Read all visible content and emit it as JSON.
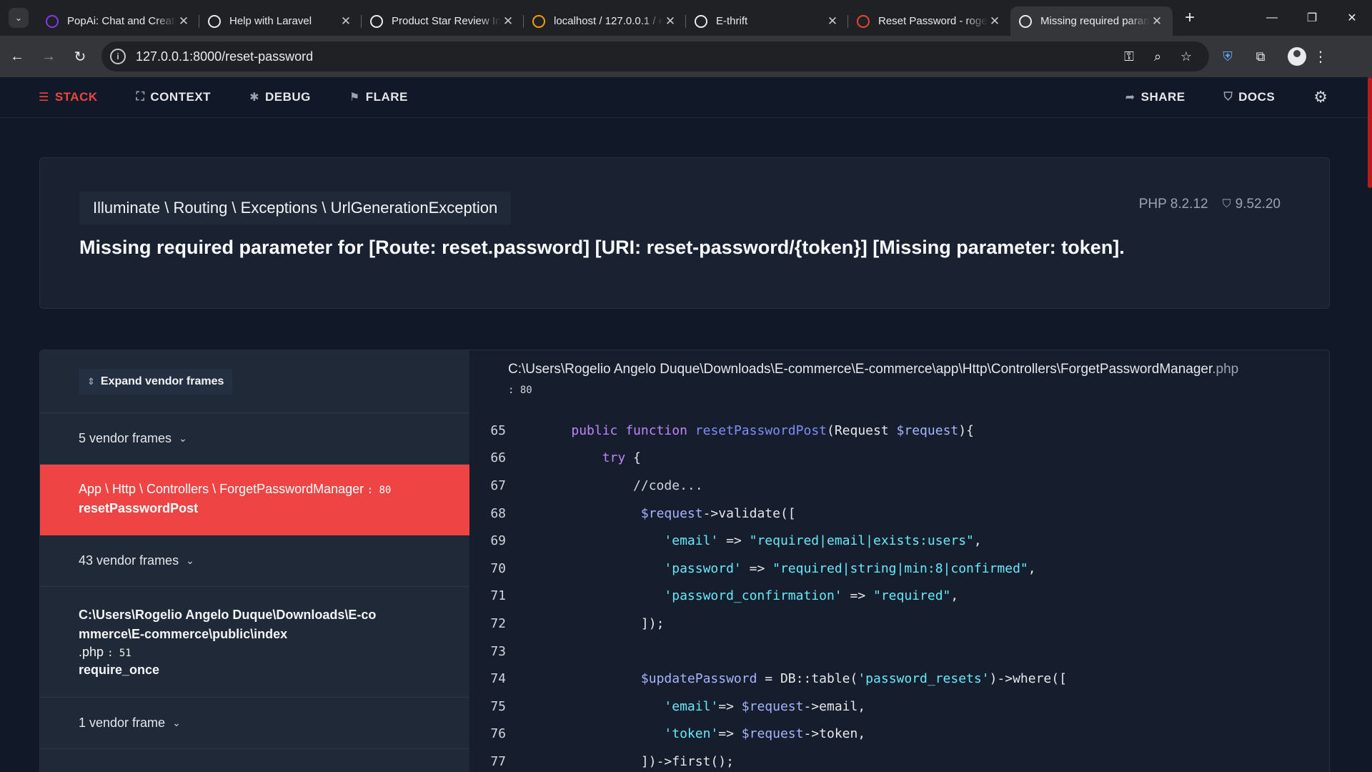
{
  "browser": {
    "tabs": [
      {
        "title": "PopAi: Chat and Create",
        "icon": "popai-icon",
        "color": "#7c3aed"
      },
      {
        "title": "Help with Laravel",
        "icon": "openai-icon",
        "color": "#e8eaed"
      },
      {
        "title": "Product Star Review In",
        "icon": "openai-icon",
        "color": "#e8eaed"
      },
      {
        "title": "localhost / 127.0.0.1 / e",
        "icon": "phpmyadmin-icon",
        "color": "#f59e0b"
      },
      {
        "title": "E-thrift",
        "icon": "globe-icon",
        "color": "#e8eaed"
      },
      {
        "title": "Reset Password - roge",
        "icon": "gmail-icon",
        "color": "#ea4335"
      },
      {
        "title": "Missing required param",
        "icon": "globe-icon",
        "color": "#e8eaed",
        "active": true
      }
    ],
    "url": "127.0.0.1:8000/reset-password"
  },
  "ignition": {
    "nav": {
      "stack": "STACK",
      "context": "CONTEXT",
      "debug": "DEBUG",
      "flare": "FLARE",
      "share": "SHARE",
      "docs": "DOCS"
    },
    "exception_class": "Illuminate \\ Routing \\ Exceptions \\ UrlGenerationException",
    "php_version": "PHP 8.2.12",
    "laravel_version": "9.52.20",
    "message": "Missing required parameter for [Route: reset.password] [URI: reset-password/{token}] [Missing parameter: token].",
    "expand_vendor": "Expand vendor frames",
    "frames": {
      "vendor_1": "5 vendor frames",
      "active_class": "App \\ Http \\ Controllers \\ ForgetPasswordManager",
      "active_line": ": 80",
      "active_fn": "resetPasswordPost",
      "vendor_2": "43 vendor frames",
      "app_path": "C:\\Users\\Rogelio Angelo Duque\\Downloads\\E-commerce\\E-commerce\\public\\index",
      "app_ext": ".php",
      "app_line": ": 51",
      "app_fn": "require_once",
      "vendor_3": "1 vendor frame"
    },
    "file_path": "C:\\Users\\Rogelio Angelo Duque\\Downloads\\E-commerce\\E-commerce\\app\\Http\\Controllers\\ForgetPasswordManager",
    "file_ext": ".php",
    "file_line": ": 80",
    "code_lines": [
      {
        "n": "65",
        "indent": "    ",
        "parts": [
          [
            "kw",
            "public "
          ],
          [
            "kw",
            "function "
          ],
          [
            "fnn",
            "resetPasswordPost"
          ],
          [
            "",
            "(Request "
          ],
          [
            "var",
            "$request"
          ],
          [
            "",
            "){"
          ]
        ]
      },
      {
        "n": "66",
        "indent": "        ",
        "parts": [
          [
            "kw",
            "try"
          ],
          [
            "",
            " {"
          ]
        ]
      },
      {
        "n": "67",
        "indent": "            ",
        "parts": [
          [
            "cmt",
            "//code..."
          ]
        ]
      },
      {
        "n": "68",
        "indent": "             ",
        "parts": [
          [
            "var",
            "$request"
          ],
          [
            "",
            "->validate(["
          ]
        ]
      },
      {
        "n": "69",
        "indent": "                ",
        "parts": [
          [
            "str",
            "'email'"
          ],
          [
            "",
            " => "
          ],
          [
            "str",
            "\"required|email|exists:users\""
          ],
          [
            "",
            ","
          ]
        ]
      },
      {
        "n": "70",
        "indent": "                ",
        "parts": [
          [
            "str",
            "'password'"
          ],
          [
            "",
            " => "
          ],
          [
            "str",
            "\"required|string|min:8|confirmed\""
          ],
          [
            "",
            ","
          ]
        ]
      },
      {
        "n": "71",
        "indent": "                ",
        "parts": [
          [
            "str",
            "'password_confirmation'"
          ],
          [
            "",
            " => "
          ],
          [
            "str",
            "\"required\""
          ],
          [
            "",
            ","
          ]
        ]
      },
      {
        "n": "72",
        "indent": "             ",
        "parts": [
          [
            "",
            "]);"
          ]
        ]
      },
      {
        "n": "73",
        "indent": "",
        "parts": []
      },
      {
        "n": "74",
        "indent": "             ",
        "parts": [
          [
            "var",
            "$updatePassword"
          ],
          [
            "",
            " = DB::table("
          ],
          [
            "str",
            "'password_resets'"
          ],
          [
            "",
            ")->where(["
          ]
        ]
      },
      {
        "n": "75",
        "indent": "                ",
        "parts": [
          [
            "str",
            "'email'"
          ],
          [
            "",
            "=> "
          ],
          [
            "var",
            "$request"
          ],
          [
            "",
            "->email,"
          ]
        ]
      },
      {
        "n": "76",
        "indent": "                ",
        "parts": [
          [
            "str",
            "'token'"
          ],
          [
            "",
            "=> "
          ],
          [
            "var",
            "$request"
          ],
          [
            "",
            "->token,"
          ]
        ]
      },
      {
        "n": "77",
        "indent": "             ",
        "parts": [
          [
            "",
            "])->first();"
          ]
        ]
      }
    ]
  }
}
